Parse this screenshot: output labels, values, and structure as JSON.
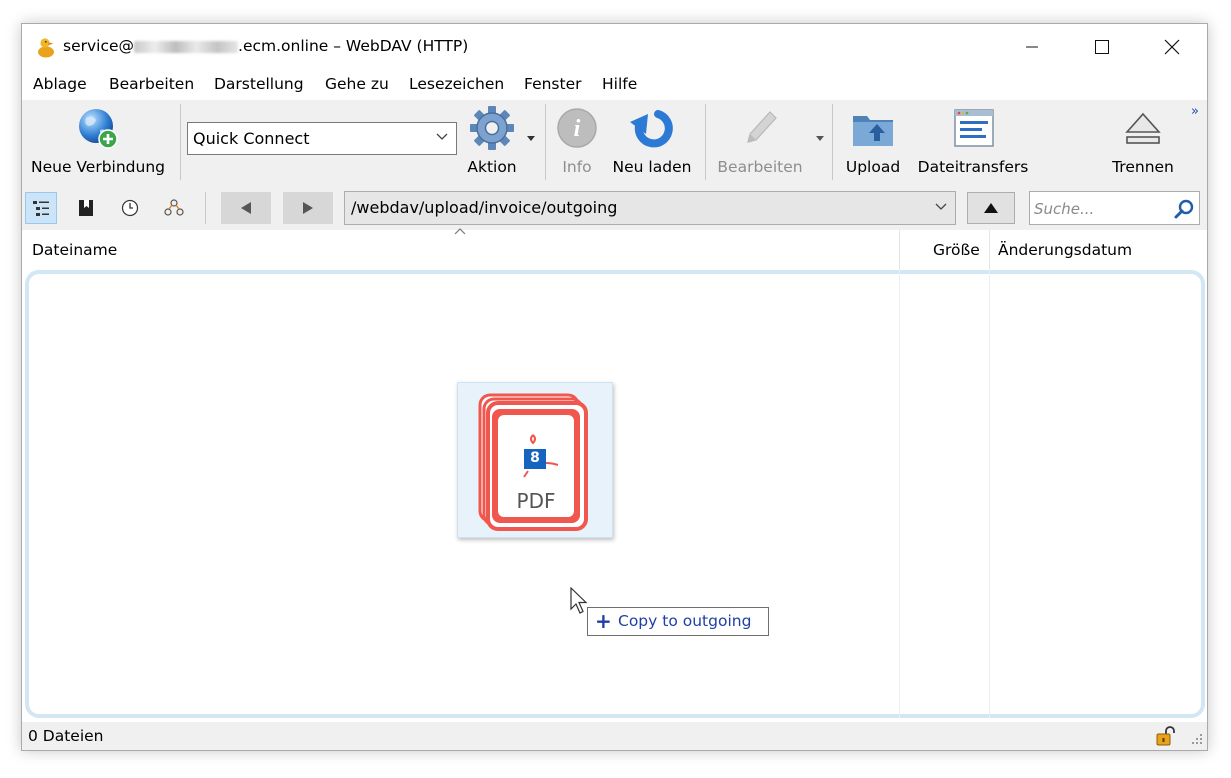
{
  "window": {
    "title_prefix": "service@",
    "title_suffix": ".ecm.online – WebDAV (HTTP)"
  },
  "menu": [
    "Ablage",
    "Bearbeiten",
    "Darstellung",
    "Gehe zu",
    "Lesezeichen",
    "Fenster",
    "Hilfe"
  ],
  "toolbar": {
    "new_connection": "Neue Verbindung",
    "quick_connect": "Quick Connect",
    "action": "Aktion",
    "info": "Info",
    "reload": "Neu laden",
    "edit": "Bearbeiten",
    "upload": "Upload",
    "transfers": "Dateitransfers",
    "disconnect": "Trennen",
    "overflow": "»"
  },
  "navbar": {
    "path": "/webdav/upload/invoice/outgoing",
    "search_placeholder": "Suche..."
  },
  "columns": {
    "filename": "Dateiname",
    "size": "Größe",
    "modified": "Änderungsdatum"
  },
  "drag": {
    "file_badge": "8",
    "file_type": "PDF",
    "tooltip": "Copy to outgoing",
    "tooltip_plus": "+"
  },
  "status": {
    "count": "0 Dateien"
  },
  "colors": {
    "accent_blue": "#1f3fa6",
    "pdf_red": "#f0574f",
    "drop_border": "#d2e6f4"
  }
}
